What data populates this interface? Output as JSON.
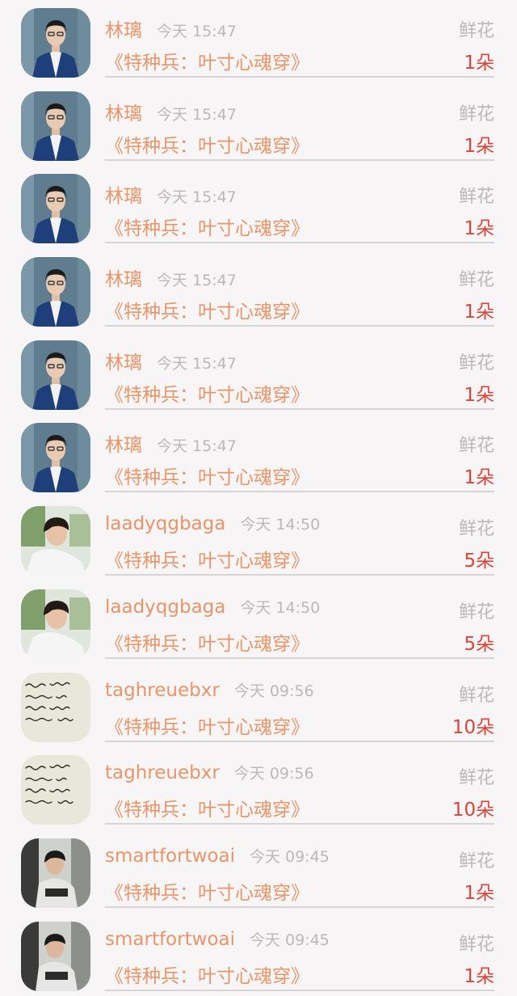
{
  "colors": {
    "background": "#f7f5f6",
    "name_text": "#e8956a",
    "time_text": "#b9b9b9",
    "count_text": "#d8453a",
    "divider": "#d6d4d5"
  },
  "records": [
    {
      "user": "林璃",
      "time": "今天 15:47",
      "gift_label": "鲜花",
      "book": "《特种兵：叶寸心魂穿》",
      "count": "1朵",
      "avatar_icon": "man-in-blue-suit-avatar"
    },
    {
      "user": "林璃",
      "time": "今天 15:47",
      "gift_label": "鲜花",
      "book": "《特种兵：叶寸心魂穿》",
      "count": "1朵",
      "avatar_icon": "man-in-blue-suit-avatar"
    },
    {
      "user": "林璃",
      "time": "今天 15:47",
      "gift_label": "鲜花",
      "book": "《特种兵：叶寸心魂穿》",
      "count": "1朵",
      "avatar_icon": "man-in-blue-suit-avatar"
    },
    {
      "user": "林璃",
      "time": "今天 15:47",
      "gift_label": "鲜花",
      "book": "《特种兵：叶寸心魂穿》",
      "count": "1朵",
      "avatar_icon": "man-in-blue-suit-avatar"
    },
    {
      "user": "林璃",
      "time": "今天 15:47",
      "gift_label": "鲜花",
      "book": "《特种兵：叶寸心魂穿》",
      "count": "1朵",
      "avatar_icon": "man-in-blue-suit-avatar"
    },
    {
      "user": "林璃",
      "time": "今天 15:47",
      "gift_label": "鲜花",
      "book": "《特种兵：叶寸心魂穿》",
      "count": "1朵",
      "avatar_icon": "man-in-blue-suit-avatar"
    },
    {
      "user": "laadyqgbaga",
      "time": "今天 14:50",
      "gift_label": "鲜花",
      "book": "《特种兵：叶寸心魂穿》",
      "count": "5朵",
      "avatar_icon": "man-in-white-shirt-avatar"
    },
    {
      "user": "laadyqgbaga",
      "time": "今天 14:50",
      "gift_label": "鲜花",
      "book": "《特种兵：叶寸心魂穿》",
      "count": "5朵",
      "avatar_icon": "man-in-white-shirt-avatar"
    },
    {
      "user": "taghreuebxr",
      "time": "今天 09:56",
      "gift_label": "鲜花",
      "book": "《特种兵：叶寸心魂穿》",
      "count": "10朵",
      "avatar_icon": "handwriting-paper-avatar"
    },
    {
      "user": "taghreuebxr",
      "time": "今天 09:56",
      "gift_label": "鲜花",
      "book": "《特种兵：叶寸心魂穿》",
      "count": "10朵",
      "avatar_icon": "handwriting-paper-avatar"
    },
    {
      "user": "smartfortwoai",
      "time": "今天 09:45",
      "gift_label": "鲜花",
      "book": "《特种兵：叶寸心魂穿》",
      "count": "1朵",
      "avatar_icon": "seated-man-photo-avatar"
    },
    {
      "user": "smartfortwoai",
      "time": "今天 09:45",
      "gift_label": "鲜花",
      "book": "《特种兵：叶寸心魂穿》",
      "count": "1朵",
      "avatar_icon": "seated-man-photo-avatar"
    }
  ]
}
